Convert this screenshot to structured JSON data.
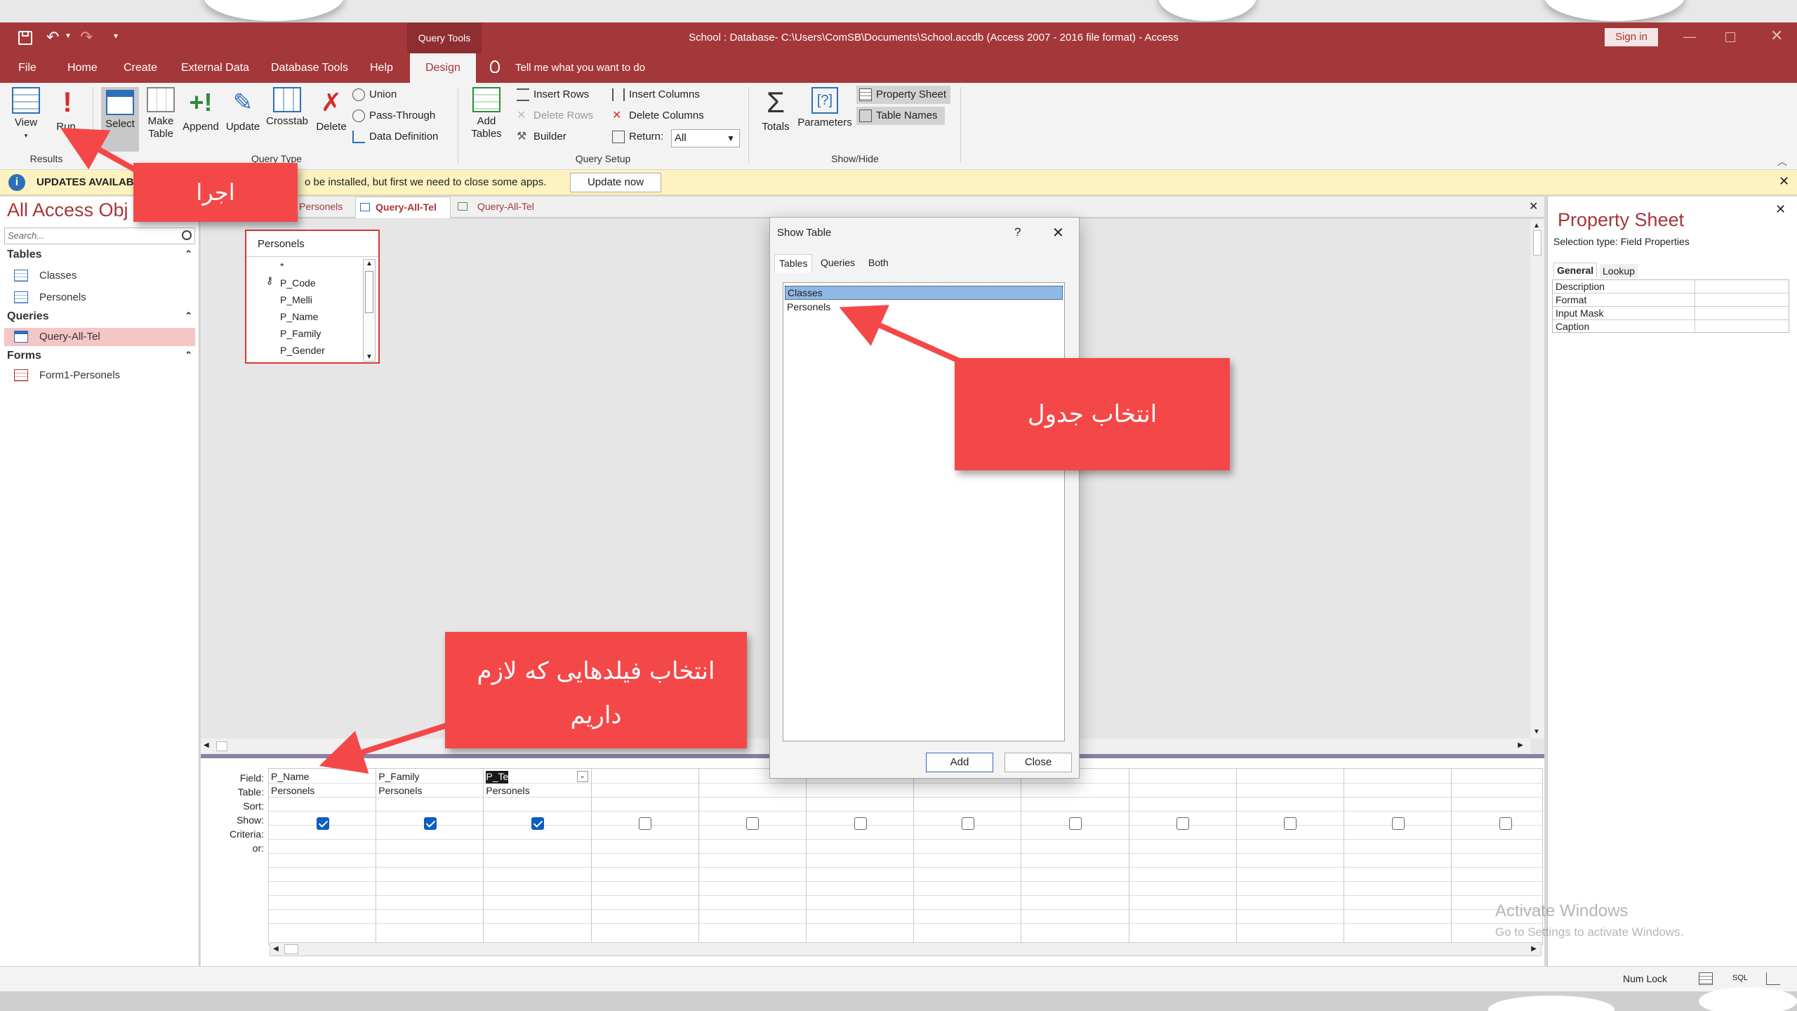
{
  "window": {
    "title": "School : Database- C:\\Users\\ComSB\\Documents\\School.accdb (Access 2007 - 2016 file format)  -  Access",
    "context_tab": "Query Tools",
    "sign_in": "Sign in"
  },
  "menu_tabs": [
    "File",
    "Home",
    "Create",
    "External Data",
    "Database Tools",
    "Help",
    "Design"
  ],
  "tell_me": "Tell me what you want to do",
  "ribbon": {
    "view": "View",
    "run": "Run",
    "results_group": "Results",
    "select": "Select",
    "make_table_1": "Make",
    "make_table_2": "Table",
    "append": "Append",
    "update": "Update",
    "crosstab": "Crosstab",
    "delete": "Delete",
    "union": "Union",
    "pass_through": "Pass-Through",
    "data_definition": "Data Definition",
    "query_type_group": "Query Type",
    "add_tables_1": "Add",
    "add_tables_2": "Tables",
    "insert_rows": "Insert Rows",
    "delete_rows": "Delete Rows",
    "builder": "Builder",
    "insert_columns": "Insert Columns",
    "delete_columns": "Delete Columns",
    "return_label": "Return:",
    "return_value": "All",
    "query_setup_group": "Query Setup",
    "totals": "Totals",
    "parameters": "Parameters",
    "property_sheet": "Property Sheet",
    "table_names": "Table Names",
    "show_hide_group": "Show/Hide"
  },
  "update_bar": {
    "title": "UPDATES AVAILAB",
    "message": "o be installed, but first we need to close some apps.",
    "button": "Update now"
  },
  "nav": {
    "title": "All Access Obj",
    "search_placeholder": "Search...",
    "tables_header": "Tables",
    "tables": [
      "Classes",
      "Personels"
    ],
    "queries_header": "Queries",
    "queries": [
      "Query-All-Tel"
    ],
    "forms_header": "Forms",
    "forms": [
      "Form1-Personels"
    ]
  },
  "doc_tabs": [
    "Personels",
    "Query-All-Tel",
    "Query-All-Tel"
  ],
  "field_list": {
    "title": "Personels",
    "fields": [
      "*",
      "P_Code",
      "P_Melli",
      "P_Name",
      "P_Family",
      "P_Gender"
    ]
  },
  "dialog": {
    "title": "Show Table",
    "help": "?",
    "tabs": [
      "Tables",
      "Queries",
      "Both"
    ],
    "items": [
      "Classes",
      "Personels"
    ],
    "selected": "Classes",
    "add": "Add",
    "close": "Close"
  },
  "query_grid": {
    "row_labels": [
      "Field:",
      "Table:",
      "Sort:",
      "Show:",
      "Criteria:",
      "or:"
    ],
    "columns": [
      {
        "field": "P_Name",
        "table": "Personels",
        "show": true
      },
      {
        "field": "P_Family",
        "table": "Personels",
        "show": true
      },
      {
        "field": "P_Tel",
        "table": "Personels",
        "show": true
      },
      {
        "field": "",
        "table": "",
        "show": false
      },
      {
        "field": "",
        "table": "",
        "show": false
      },
      {
        "field": "",
        "table": "",
        "show": false
      },
      {
        "field": "",
        "table": "",
        "show": false
      },
      {
        "field": "",
        "table": "",
        "show": false
      },
      {
        "field": "",
        "table": "",
        "show": false
      },
      {
        "field": "",
        "table": "",
        "show": false
      },
      {
        "field": "",
        "table": "",
        "show": false
      },
      {
        "field": "",
        "table": "",
        "show": false
      }
    ]
  },
  "property_sheet": {
    "title": "Property Sheet",
    "selection_type": "Selection type:  Field Properties",
    "tabs": [
      "General",
      "Lookup"
    ],
    "rows": [
      "Description",
      "Format",
      "Input Mask",
      "Caption"
    ]
  },
  "callouts": {
    "run": "اجرا",
    "select_table": "انتخاب جدول",
    "select_fields_1": "انتخاب فیلدهایی که لازم",
    "select_fields_2": "داریم"
  },
  "watermark": {
    "line1": "Activate Windows",
    "line2": "Go to Settings to activate Windows."
  },
  "status": {
    "num_lock": "Num Lock",
    "sql": "SQL"
  },
  "colors": {
    "brand": "#a4373a",
    "callout": "#f44848",
    "checkbox": "#0a5ec2",
    "selection": "#8fb8e6"
  }
}
